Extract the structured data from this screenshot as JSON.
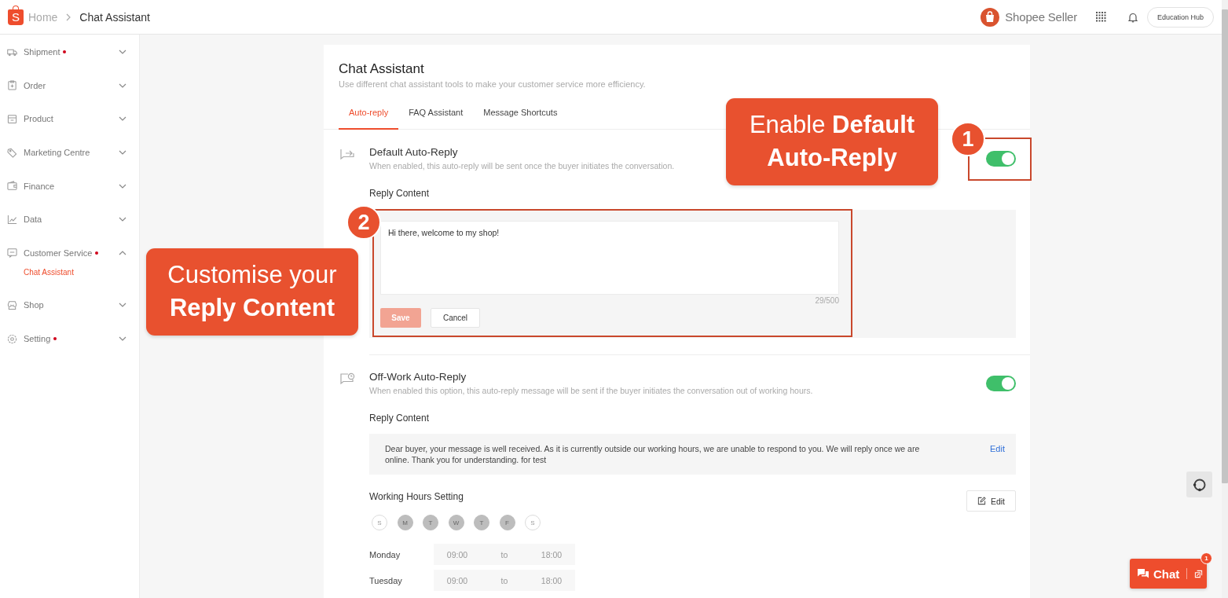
{
  "header": {
    "logo_mark": "S",
    "breadcrumb": [
      {
        "label": "Home"
      },
      {
        "label": "Chat Assistant"
      }
    ],
    "brand": "Shopee Seller",
    "education_hub": "Education Hub"
  },
  "sidebar": {
    "items": [
      {
        "label": "Shipment",
        "dot": true,
        "expanded": false
      },
      {
        "label": "Order",
        "dot": false,
        "expanded": false
      },
      {
        "label": "Product",
        "dot": false,
        "expanded": false
      },
      {
        "label": "Marketing Centre",
        "dot": false,
        "expanded": false
      },
      {
        "label": "Finance",
        "dot": false,
        "expanded": false
      },
      {
        "label": "Data",
        "dot": false,
        "expanded": false
      },
      {
        "label": "Customer Service",
        "dot": true,
        "expanded": true,
        "children": [
          {
            "label": "Chat Assistant",
            "selected": true
          }
        ]
      },
      {
        "label": "Shop",
        "dot": false,
        "expanded": false
      },
      {
        "label": "Setting",
        "dot": true,
        "expanded": false
      }
    ]
  },
  "page": {
    "title": "Chat Assistant",
    "subtitle": "Use different chat assistant tools to make your customer service more efficiency.",
    "tabs": [
      {
        "label": "Auto-reply",
        "selected": true
      },
      {
        "label": "FAQ Assistant",
        "selected": false
      },
      {
        "label": "Message Shortcuts",
        "selected": false
      }
    ]
  },
  "default_auto_reply": {
    "title": "Default Auto-Reply",
    "description": "When enabled, this auto-reply will be sent once the buyer initiates the conversation.",
    "on": true,
    "reply_label": "Reply Content",
    "editor": {
      "value": "Hi there, welcome to my shop!",
      "counter": "29/500",
      "save": {
        "label": "Save",
        "disabled": true
      },
      "cancel": "Cancel"
    }
  },
  "off_work_auto_reply": {
    "title": "Off-Work Auto-Reply",
    "description": "When enabled this option, this auto-reply message will be sent if the buyer initiates the conversation out of working hours.",
    "on": true,
    "reply_label": "Reply Content",
    "message": "Dear buyer, your message is well received. As it is currently outside our working hours, we are unable to respond to you. We will reply once we are online. Thank you for understanding. for test",
    "edit": "Edit",
    "working_hours": {
      "title": "Working Hours Setting",
      "edit": "Edit",
      "days": [
        {
          "label": "S",
          "selected": false
        },
        {
          "label": "M",
          "selected": true
        },
        {
          "label": "T",
          "selected": true
        },
        {
          "label": "W",
          "selected": true
        },
        {
          "label": "T",
          "selected": true
        },
        {
          "label": "F",
          "selected": true
        },
        {
          "label": "S",
          "selected": false
        }
      ],
      "schedule": [
        {
          "day": "Monday",
          "start": "09:00",
          "separator": "to",
          "end": "18:00"
        },
        {
          "day": "Tuesday",
          "start": "09:00",
          "separator": "to",
          "end": "18:00"
        }
      ]
    }
  },
  "annotations": [
    {
      "number": "1",
      "text": "Enable **Default Auto-Reply**"
    },
    {
      "number": "2",
      "text": "Customise your **Reply Content**"
    }
  ],
  "chat_widget": {
    "label": "Chat",
    "badge": "1"
  }
}
